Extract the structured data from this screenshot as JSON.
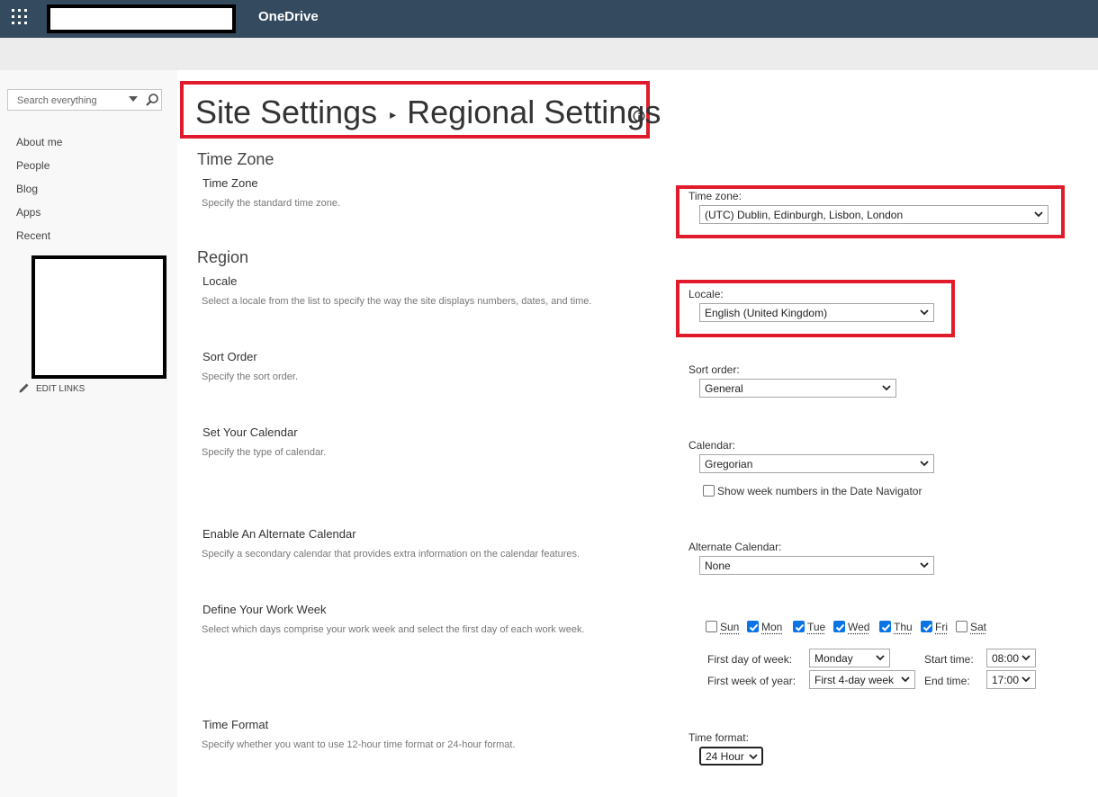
{
  "topbar": {
    "app_name": "OneDrive",
    "bg_color": "#344a5e"
  },
  "search": {
    "placeholder": "Search everything"
  },
  "nav": {
    "links": [
      "About me",
      "People",
      "Blog",
      "Apps",
      "Recent"
    ],
    "edit_links_label": "EDIT LINKS"
  },
  "page": {
    "breadcrumb_parent": "Site Settings",
    "breadcrumb_current": "Regional Settings"
  },
  "time_zone_section": {
    "heading": "Time Zone",
    "field_title": "Time Zone",
    "description": "Specify the standard time zone.",
    "control_label": "Time zone:",
    "value": "(UTC) Dublin, Edinburgh, Lisbon, London"
  },
  "region_section": {
    "heading": "Region",
    "locale": {
      "title": "Locale",
      "description": "Select a locale from the list to specify the way the site displays numbers, dates, and time.",
      "control_label": "Locale:",
      "value": "English (United Kingdom)"
    },
    "sort_order": {
      "title": "Sort Order",
      "description": "Specify the sort order.",
      "control_label": "Sort order:",
      "value": "General"
    },
    "calendar": {
      "title": "Set Your Calendar",
      "description": "Specify the type of calendar.",
      "control_label": "Calendar:",
      "value": "Gregorian",
      "show_week_numbers_label": "Show week numbers in the Date Navigator",
      "show_week_numbers_checked": false
    },
    "alternate_calendar": {
      "title": "Enable An Alternate Calendar",
      "description": "Specify a secondary calendar that provides extra information on the calendar features.",
      "control_label": "Alternate Calendar:",
      "value": "None"
    },
    "work_week": {
      "title": "Define Your Work Week",
      "description": "Select which days comprise your work week and select the first day of each work week.",
      "days": [
        {
          "label": "Sun",
          "checked": false
        },
        {
          "label": "Mon",
          "checked": true
        },
        {
          "label": "Tue",
          "checked": true
        },
        {
          "label": "Wed",
          "checked": true
        },
        {
          "label": "Thu",
          "checked": true
        },
        {
          "label": "Fri",
          "checked": true
        },
        {
          "label": "Sat",
          "checked": false
        }
      ],
      "first_day_label": "First day of week:",
      "first_day_value": "Monday",
      "first_week_label": "First week of year:",
      "first_week_value": "First 4-day week",
      "start_time_label": "Start time:",
      "start_time_value": "08:00",
      "end_time_label": "End time:",
      "end_time_value": "17:00"
    },
    "time_format": {
      "title": "Time Format",
      "description": "Specify whether you want to use 12-hour time format or 24-hour format.",
      "control_label": "Time format:",
      "value": "24 Hour"
    }
  },
  "colors": {
    "highlight_red": "#e01b2c",
    "checkbox_blue": "#0b74e5"
  }
}
